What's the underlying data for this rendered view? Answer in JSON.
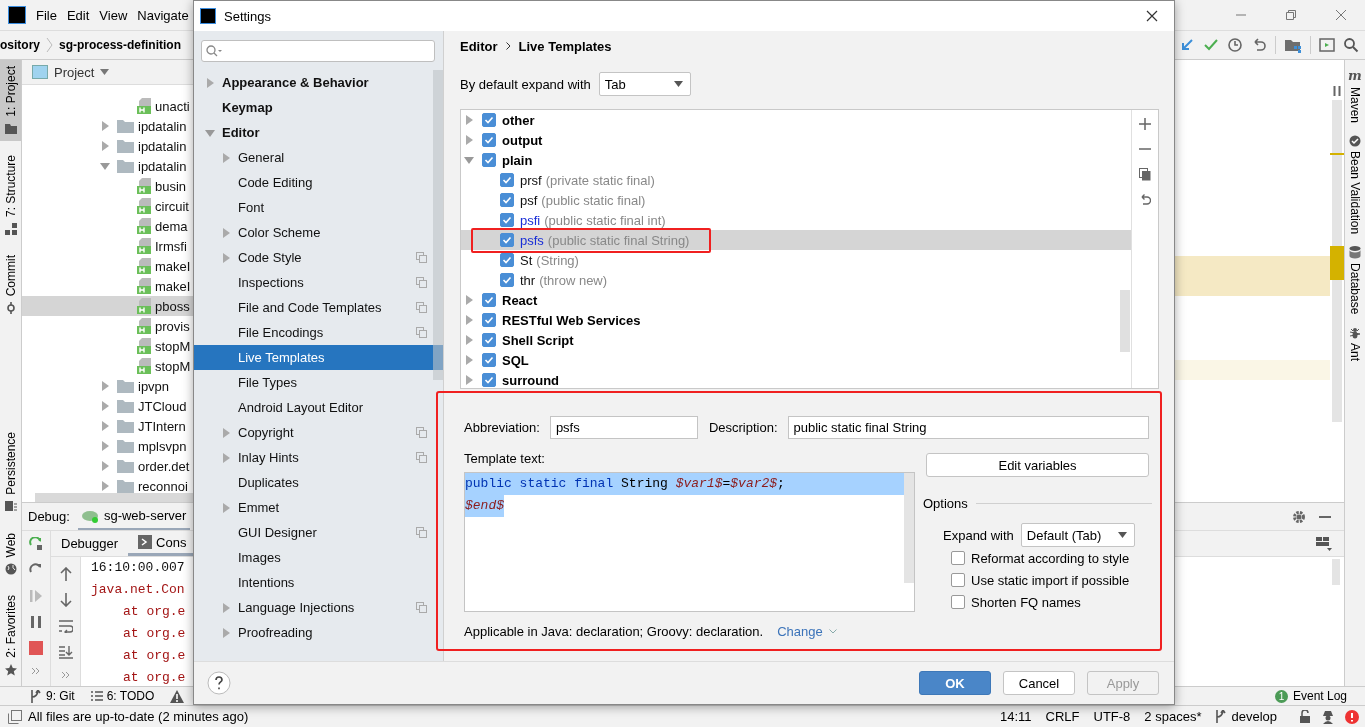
{
  "ide": {
    "menu": [
      "File",
      "Edit",
      "View",
      "Navigate"
    ],
    "breadcrumb": [
      "ository",
      "sg-process-definition"
    ],
    "left_tool_windows_top": [
      {
        "label": "1: Project",
        "kind": "project",
        "selected": true
      },
      {
        "label": "7: Structure",
        "kind": "structure",
        "selected": false
      },
      {
        "label": "Commit",
        "kind": "commit",
        "selected": false
      }
    ],
    "left_tool_windows_bottom": [
      {
        "label": "Persistence",
        "kind": "persistence",
        "selected": false
      },
      {
        "label": "Web",
        "kind": "web",
        "selected": false
      },
      {
        "label": "2: Favorites",
        "kind": "favorites",
        "selected": false
      }
    ],
    "right_tool_windows": [
      {
        "label": "Maven",
        "kind": "maven",
        "icon_text": "m"
      },
      {
        "label": "Bean Validation",
        "kind": "bean"
      },
      {
        "label": "Database",
        "kind": "database"
      },
      {
        "label": "Ant",
        "kind": "ant"
      }
    ],
    "project_panel": {
      "title": "Project",
      "tree": [
        {
          "name": "unacti",
          "kind": "file",
          "selected": false
        },
        {
          "name": "ipdatalin",
          "kind": "folder",
          "expanded": false,
          "selected": false
        },
        {
          "name": "ipdatalin",
          "kind": "folder",
          "expanded": false,
          "selected": false
        },
        {
          "name": "ipdatalin",
          "kind": "folder",
          "expanded": true,
          "selected": false,
          "children": [
            {
              "name": "busin",
              "kind": "file",
              "selected": false
            },
            {
              "name": "circuit",
              "kind": "file",
              "selected": false
            },
            {
              "name": "dema",
              "kind": "file",
              "selected": false
            },
            {
              "name": "Irmsfi",
              "kind": "file",
              "selected": false
            },
            {
              "name": "makeI",
              "kind": "file",
              "selected": false
            },
            {
              "name": "makeI",
              "kind": "file",
              "selected": false
            },
            {
              "name": "pboss",
              "kind": "file",
              "selected": true
            },
            {
              "name": "provis",
              "kind": "file",
              "selected": false
            },
            {
              "name": "stopM",
              "kind": "file",
              "selected": false
            },
            {
              "name": "stopM",
              "kind": "file",
              "selected": false
            }
          ]
        },
        {
          "name": "ipvpn",
          "kind": "folder",
          "expanded": false,
          "selected": false
        },
        {
          "name": "JTCloud",
          "kind": "folder",
          "expanded": false,
          "selected": false
        },
        {
          "name": "JTIntern",
          "kind": "folder",
          "expanded": false,
          "selected": false
        },
        {
          "name": "mplsvpn",
          "kind": "folder",
          "expanded": false,
          "selected": false
        },
        {
          "name": "order.det",
          "kind": "folder",
          "expanded": false,
          "selected": false
        },
        {
          "name": "reconnoi",
          "kind": "folder",
          "expanded": false,
          "selected": false
        }
      ]
    },
    "debug_panel": {
      "label": "Debug:",
      "session": "sg-web-server",
      "tabs": [
        {
          "label": "Debugger",
          "selected": false
        },
        {
          "label": "Cons",
          "selected": true
        }
      ],
      "console": [
        {
          "kind": "time",
          "text": "16:10:00.007"
        },
        {
          "kind": "error",
          "text": "java.net.Con"
        },
        {
          "kind": "trace",
          "text": "at org.e"
        },
        {
          "kind": "trace",
          "text": "at org.e"
        },
        {
          "kind": "trace",
          "text": "at org.e"
        },
        {
          "kind": "trace",
          "text": "at org.e"
        }
      ]
    },
    "bottom_tools": [
      {
        "label": "9: Git",
        "kind": "git"
      },
      {
        "label": "6: TODO",
        "kind": "todo"
      }
    ],
    "event_log": {
      "count": "1",
      "label": "Event Log"
    },
    "status": {
      "message": "All files are up-to-date (2 minutes ago)",
      "position": "14:11",
      "line_ending": "CRLF",
      "encoding": "UTF-8",
      "indent": "2 spaces*",
      "branch": "develop"
    }
  },
  "dialog": {
    "title": "Settings",
    "settings_tree": [
      {
        "label": "Appearance & Behavior",
        "expandable": true,
        "expanded": false,
        "selected": false
      },
      {
        "label": "Keymap",
        "expandable": false,
        "selected": false
      },
      {
        "label": "Editor",
        "expandable": true,
        "expanded": true,
        "selected": false,
        "children": [
          {
            "label": "General",
            "expandable": true,
            "project_level": false,
            "selected": false
          },
          {
            "label": "Code Editing",
            "expandable": false,
            "project_level": false,
            "selected": false
          },
          {
            "label": "Font",
            "expandable": false,
            "project_level": false,
            "selected": false
          },
          {
            "label": "Color Scheme",
            "expandable": true,
            "project_level": false,
            "selected": false
          },
          {
            "label": "Code Style",
            "expandable": true,
            "project_level": true,
            "selected": false
          },
          {
            "label": "Inspections",
            "expandable": false,
            "project_level": true,
            "selected": false
          },
          {
            "label": "File and Code Templates",
            "expandable": false,
            "project_level": true,
            "selected": false
          },
          {
            "label": "File Encodings",
            "expandable": false,
            "project_level": true,
            "selected": false
          },
          {
            "label": "Live Templates",
            "expandable": false,
            "project_level": false,
            "selected": true
          },
          {
            "label": "File Types",
            "expandable": false,
            "project_level": false,
            "selected": false
          },
          {
            "label": "Android Layout Editor",
            "expandable": false,
            "project_level": false,
            "selected": false
          },
          {
            "label": "Copyright",
            "expandable": true,
            "project_level": true,
            "selected": false
          },
          {
            "label": "Inlay Hints",
            "expandable": true,
            "project_level": true,
            "selected": false
          },
          {
            "label": "Duplicates",
            "expandable": false,
            "project_level": false,
            "selected": false
          },
          {
            "label": "Emmet",
            "expandable": true,
            "project_level": false,
            "selected": false
          },
          {
            "label": "GUI Designer",
            "expandable": false,
            "project_level": true,
            "selected": false
          },
          {
            "label": "Images",
            "expandable": false,
            "project_level": false,
            "selected": false
          },
          {
            "label": "Intentions",
            "expandable": false,
            "project_level": false,
            "selected": false
          },
          {
            "label": "Language Injections",
            "expandable": true,
            "project_level": true,
            "selected": false
          },
          {
            "label": "Proofreading",
            "expandable": true,
            "project_level": false,
            "selected": false
          }
        ]
      }
    ],
    "breadcrumb": [
      "Editor",
      "Live Templates"
    ],
    "expand_with_label": "By default expand with",
    "expand_with_value": "Tab",
    "template_groups": [
      {
        "name": "other",
        "checked": true,
        "expanded": false
      },
      {
        "name": "output",
        "checked": true,
        "expanded": false
      },
      {
        "name": "plain",
        "checked": true,
        "expanded": true,
        "children": [
          {
            "abbreviation": "prsf",
            "description": "(private static final)",
            "checked": true,
            "modified": false,
            "selected": false,
            "highlighted": false
          },
          {
            "abbreviation": "psf",
            "description": "(public static final)",
            "checked": true,
            "modified": false,
            "selected": false,
            "highlighted": false
          },
          {
            "abbreviation": "psfi",
            "description": "(public static final int)",
            "checked": true,
            "modified": true,
            "selected": false,
            "highlighted": false
          },
          {
            "abbreviation": "psfs",
            "description": "(public static final String)",
            "checked": true,
            "modified": true,
            "selected": true,
            "highlighted": true
          },
          {
            "abbreviation": "St",
            "description": "(String)",
            "checked": true,
            "modified": false,
            "selected": false,
            "highlighted": false
          },
          {
            "abbreviation": "thr",
            "description": "(throw new)",
            "checked": true,
            "modified": false,
            "selected": false,
            "highlighted": false
          }
        ]
      },
      {
        "name": "React",
        "checked": true,
        "expanded": false
      },
      {
        "name": "RESTful Web Services",
        "checked": true,
        "expanded": false
      },
      {
        "name": "Shell Script",
        "checked": true,
        "expanded": false
      },
      {
        "name": "SQL",
        "checked": true,
        "expanded": false
      },
      {
        "name": "surround",
        "checked": true,
        "expanded": false
      }
    ],
    "details": {
      "highlighted": true,
      "abbreviation_label": "Abbreviation:",
      "abbreviation": "psfs",
      "description_label": "Description:",
      "description": "public static final String",
      "template_text_label": "Template text:",
      "template_text": [
        [
          {
            "kind": "keyword",
            "text": "public static final"
          },
          {
            "kind": "plain",
            "text": " String "
          },
          {
            "kind": "variable",
            "text": "$var1$"
          },
          {
            "kind": "plain",
            "text": "="
          },
          {
            "kind": "variable",
            "text": "$var2$"
          },
          {
            "kind": "plain",
            "text": ";"
          }
        ],
        [
          {
            "kind": "variable",
            "text": "$end$"
          }
        ]
      ],
      "edit_variables": "Edit variables",
      "options_label": "Options",
      "expand_with_label": "Expand with",
      "expand_with_value": "Default (Tab)",
      "options": [
        {
          "label": "Reformat according to style",
          "checked": false
        },
        {
          "label": "Use static import if possible",
          "checked": false
        },
        {
          "label": "Shorten FQ names",
          "checked": false
        }
      ],
      "applicable": "Applicable in Java: declaration; Groovy: declaration.",
      "change_link": "Change"
    },
    "buttons": [
      {
        "label": "OK",
        "kind": "primary",
        "disabled": false
      },
      {
        "label": "Cancel",
        "kind": "normal",
        "disabled": false
      },
      {
        "label": "Apply",
        "kind": "normal",
        "disabled": true
      }
    ]
  }
}
